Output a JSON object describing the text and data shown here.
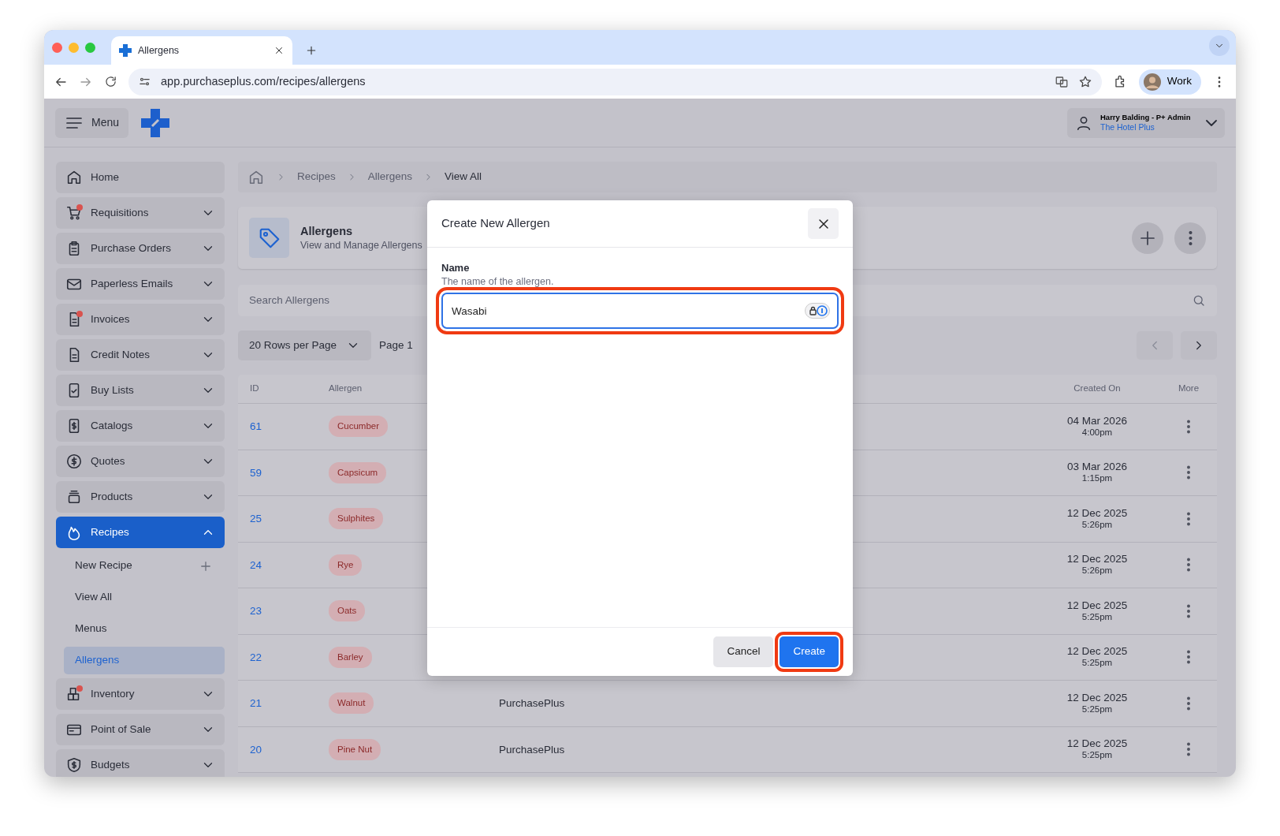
{
  "browser": {
    "tab_title": "Allergens",
    "url": "app.purchaseplus.com/recipes/allergens",
    "profile": "Work"
  },
  "header": {
    "menu": "Menu",
    "user": "Harry Balding - P+ Admin",
    "organisation": "The Hotel Plus"
  },
  "sidebar": {
    "items": [
      {
        "label": "Home",
        "kind": "link",
        "alert": false,
        "selected": false
      },
      {
        "label": "Requisitions",
        "kind": "group",
        "alert": true,
        "selected": false,
        "expanded": false
      },
      {
        "label": "Purchase Orders",
        "kind": "group",
        "alert": false,
        "selected": false,
        "expanded": false
      },
      {
        "label": "Paperless Emails",
        "kind": "group",
        "alert": false,
        "selected": false,
        "expanded": false
      },
      {
        "label": "Invoices",
        "kind": "group",
        "alert": true,
        "selected": false,
        "expanded": false
      },
      {
        "label": "Credit Notes",
        "kind": "group",
        "alert": false,
        "selected": false,
        "expanded": false
      },
      {
        "label": "Buy Lists",
        "kind": "group",
        "alert": false,
        "selected": false,
        "expanded": false
      },
      {
        "label": "Catalogs",
        "kind": "group",
        "alert": false,
        "selected": false,
        "expanded": false
      },
      {
        "label": "Quotes",
        "kind": "group",
        "alert": false,
        "selected": false,
        "expanded": false
      },
      {
        "label": "Products",
        "kind": "group",
        "alert": false,
        "selected": false,
        "expanded": false
      },
      {
        "label": "Recipes",
        "kind": "group",
        "alert": false,
        "selected": true,
        "expanded": true,
        "children": [
          {
            "label": "New Recipe",
            "kind": "add",
            "selected": false
          },
          {
            "label": "View All",
            "kind": "link",
            "selected": false
          },
          {
            "label": "Menus",
            "kind": "link",
            "selected": false
          },
          {
            "label": "Allergens",
            "kind": "link",
            "selected": true
          }
        ]
      },
      {
        "label": "Inventory",
        "kind": "group",
        "alert": true,
        "selected": false,
        "expanded": false
      },
      {
        "label": "Point of Sale",
        "kind": "group",
        "alert": false,
        "selected": false,
        "expanded": false
      },
      {
        "label": "Budgets",
        "kind": "group",
        "alert": false,
        "selected": false,
        "expanded": false
      }
    ]
  },
  "breadcrumb": [
    "Recipes",
    "Allergens",
    "View All"
  ],
  "page_header": {
    "title": "Allergens",
    "subtitle": "View and Manage Allergens"
  },
  "search": {
    "placeholder": "Search Allergens"
  },
  "pagination": {
    "rows_per_page": "20 Rows per Page",
    "page": "Page 1"
  },
  "table": {
    "columns": [
      "ID",
      "Allergen",
      "Created On",
      "More"
    ],
    "rows": [
      {
        "id": "61",
        "allergen": "Cucumber",
        "created_date": "04 Mar 2026",
        "created_time": "4:00pm"
      },
      {
        "id": "59",
        "allergen": "Capsicum",
        "created_date": "03 Mar 2026",
        "created_time": "1:15pm"
      },
      {
        "id": "25",
        "allergen": "Sulphites",
        "created_date": "12 Dec 2025",
        "created_time": "5:26pm"
      },
      {
        "id": "24",
        "allergen": "Rye",
        "created_date": "12 Dec 2025",
        "created_time": "5:26pm"
      },
      {
        "id": "23",
        "allergen": "Oats",
        "created_date": "12 Dec 2025",
        "created_time": "5:25pm"
      },
      {
        "id": "22",
        "allergen": "Barley",
        "created_date": "12 Dec 2025",
        "created_time": "5:25pm"
      },
      {
        "id": "21",
        "allergen": "Walnut",
        "column_3": "PurchasePlus",
        "created_date": "12 Dec 2025",
        "created_time": "5:25pm"
      },
      {
        "id": "20",
        "allergen": "Pine Nut",
        "column_3": "PurchasePlus",
        "created_date": "12 Dec 2025",
        "created_time": "5:25pm"
      }
    ]
  },
  "modal": {
    "title": "Create New Allergen",
    "field": {
      "label": "Name",
      "help": "The name of the allergen.",
      "value": "Wasabi",
      "highlighted": true
    },
    "buttons": [
      {
        "label": "Cancel",
        "kind": "secondary",
        "highlighted": false
      },
      {
        "label": "Create",
        "kind": "primary",
        "highlighted": true
      }
    ]
  }
}
